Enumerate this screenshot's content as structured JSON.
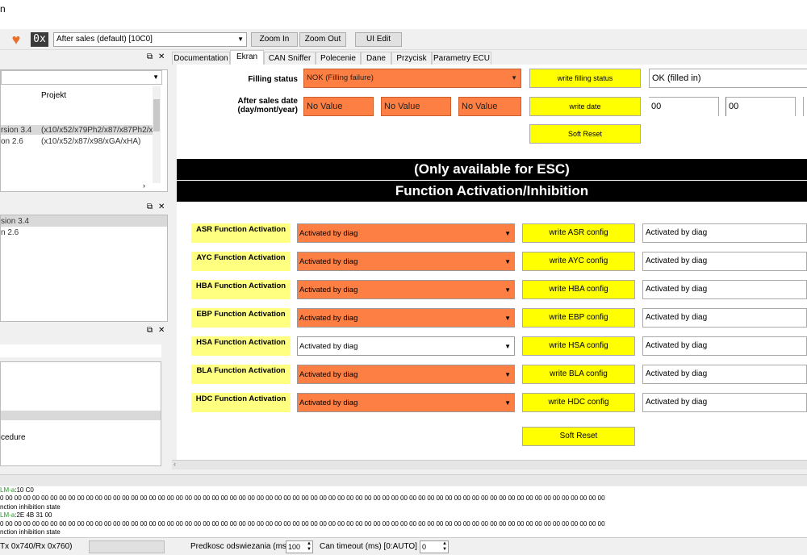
{
  "window": {
    "title": "n"
  },
  "toolbar": {
    "hex_label": "0x",
    "profile": "After sales (default) [10C0]",
    "zoom_in": "Zoom In",
    "zoom_out": "Zoom Out",
    "ui_edit": "UI Edit"
  },
  "left_panels": {
    "top": {
      "column_header": "Projekt",
      "rows": [
        {
          "name": "rsion 3.4",
          "project": "(x10/x52/x79Ph2/x87/x87Ph2/x9"
        },
        {
          "name": "on 2.6",
          "project": "(x10/x52/x87/x98/xGA/xHA)"
        }
      ]
    },
    "middle": {
      "rows": [
        "sion 3.4",
        "n 2.6"
      ]
    },
    "bottom": {
      "item": "cedure"
    }
  },
  "tabs": [
    "Documentation",
    "Ekran",
    "CAN Sniffer",
    "Polecenie",
    "Dane",
    "Przycisk",
    "Parametry ECU"
  ],
  "main": {
    "filling": {
      "label": "Filling status",
      "value": "NOK (Filling failure)",
      "button": "write filling status",
      "status": "OK (filled in)"
    },
    "date": {
      "label": "After sales date\n(day/mont/year)",
      "fields": [
        "No Value",
        "No Value",
        "No Value"
      ],
      "button": "write date",
      "values": [
        "00",
        "00"
      ]
    },
    "soft_reset_1": "Soft Reset",
    "banner1": "(Only available for ESC)",
    "banner2": "Function Activation/Inhibition",
    "functions": [
      {
        "label": "ASR Function Activation",
        "value": "Activated by diag",
        "button": "write ASR config",
        "status": "Activated by diag"
      },
      {
        "label": "AYC Function Activation",
        "value": "Activated by diag",
        "button": "write AYC config",
        "status": "Activated by diag"
      },
      {
        "label": "HBA Function Activation",
        "value": "Activated by diag",
        "button": "write HBA config",
        "status": "Activated by diag"
      },
      {
        "label": "EBP Function Activation",
        "value": "Activated by diag",
        "button": "write EBP config",
        "status": "Activated by diag"
      },
      {
        "label": "HSA Function Activation",
        "value": "Activated by diag",
        "button": "write HSA config",
        "status": "Activated by diag"
      },
      {
        "label": "BLA Function Activation",
        "value": "Activated by diag",
        "button": "write BLA config",
        "status": "Activated by diag"
      },
      {
        "label": "HDC Function Activation",
        "value": "Activated by diag",
        "button": "write HDC config",
        "status": "Activated by diag"
      }
    ],
    "soft_reset_2": "Soft Reset"
  },
  "log": {
    "lines": [
      {
        "prefix": "LM-a",
        "text": ":10 C0"
      },
      {
        "text": "0 00 00 00 00 00 00 00 00 00 00 00 00 00 00 00 00 00 00 00 00 00 00 00 00 00 00 00 00 00 00 00 00 00 00 00 00 00 00 00 00 00 00 00 00 00 00 00 00 00 00 00 00 00 00 00 00 00 00 00 00 00 00 00 00 00 00 00"
      },
      {
        "text": "nction inhibition state"
      },
      {
        "prefix": "LM-a",
        "text": ":2E 4B 31 00"
      },
      {
        "text": "0 00 00 00 00 00 00 00 00 00 00 00 00 00 00 00 00 00 00 00 00 00 00 00 00 00 00 00 00 00 00 00 00 00 00 00 00 00 00 00 00 00 00 00 00 00 00 00 00 00 00 00 00 00 00 00 00 00 00 00 00 00 00 00 00 00 00 00"
      },
      {
        "text": "nction inhibition state"
      }
    ]
  },
  "status": {
    "ids": "Tx 0x740/Rx 0x760)",
    "refresh_label": "Predkosc odswiezania (ms)",
    "refresh_value": "100",
    "timeout_label": "Can timeout (ms) [0:AUTO] :",
    "timeout_value": "0"
  },
  "colors": {
    "orange": "#fe7f43",
    "yellow": "#ffff00",
    "label_yellow": "#ffff80",
    "banner": "#000000"
  }
}
